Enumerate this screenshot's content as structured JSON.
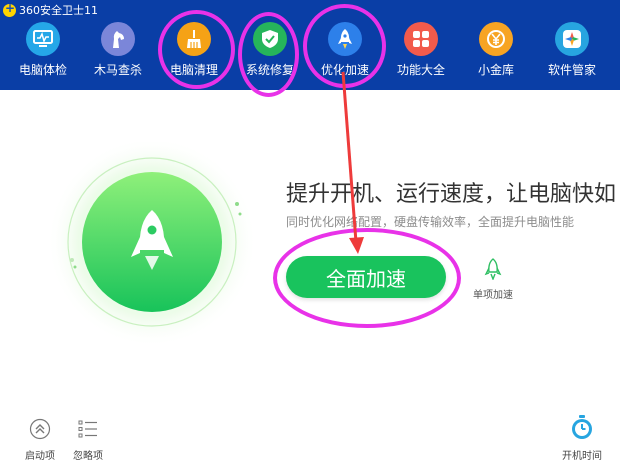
{
  "app": {
    "title": "360安全卫士11"
  },
  "toolbar": {
    "items": [
      {
        "label": "电脑体检",
        "icon": "monitor-check-icon",
        "color": "#25a7e8"
      },
      {
        "label": "木马查杀",
        "icon": "horse-icon",
        "color": "#7b86d9"
      },
      {
        "label": "电脑清理",
        "icon": "broom-icon",
        "color": "#f5a216"
      },
      {
        "label": "系统修复",
        "icon": "shield-icon",
        "color": "#26b55b"
      },
      {
        "label": "优化加速",
        "icon": "rocket-icon",
        "color": "#2d80ea"
      },
      {
        "label": "功能大全",
        "icon": "grid-icon",
        "color": "#f25b4c"
      },
      {
        "label": "小金库",
        "icon": "coin-icon",
        "color": "#f7a423"
      },
      {
        "label": "软件管家",
        "icon": "app-store-icon",
        "color": "#27a5e0"
      }
    ]
  },
  "main": {
    "headline": "提升开机、运行速度，让电脑快如",
    "subline": "同时优化网络配置，硬盘传输效率，全面提升电脑性能",
    "primary_button": "全面加速",
    "secondary_button": "单项加速"
  },
  "bottom": {
    "startup": "启动项",
    "ignored": "忽略项",
    "boot_time": "开机时间"
  },
  "colors": {
    "topbar": "#0a3ea6",
    "accent_green": "#19c35d",
    "annotation": "#e832e8",
    "arrow": "#ee3b3b"
  }
}
